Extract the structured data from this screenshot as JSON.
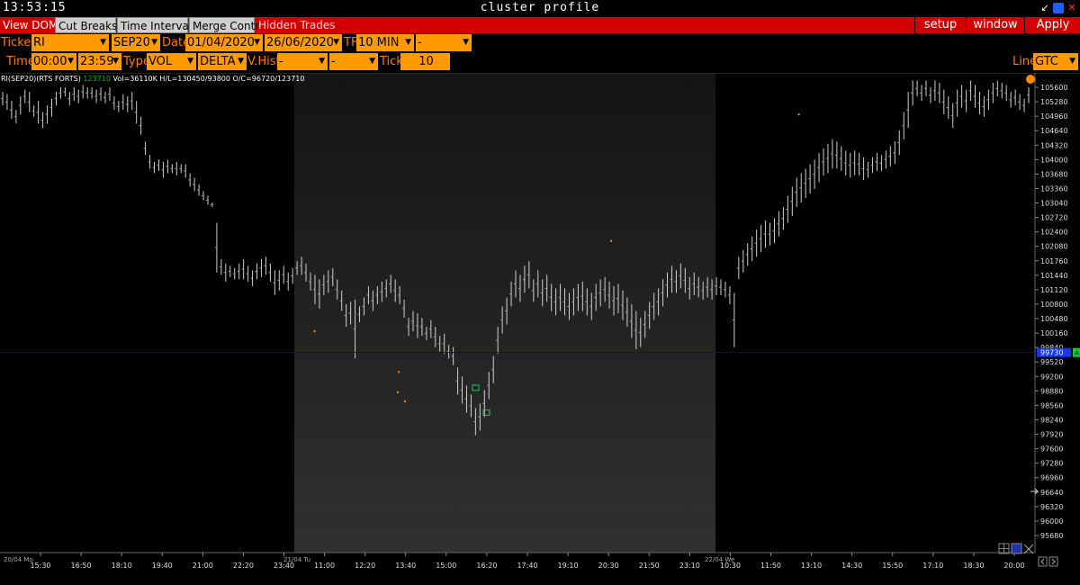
{
  "titlebar": {
    "clock": "13:53:15",
    "title": "cluster profile"
  },
  "menubar": {
    "tabs": [
      {
        "label": "View DOM",
        "state": "off"
      },
      {
        "label": "Cut Breaks",
        "state": "on"
      },
      {
        "label": "Time Interval",
        "state": "on"
      },
      {
        "label": "Merge Contr",
        "state": "on"
      },
      {
        "label": "Hidden Trades",
        "state": "hid"
      }
    ],
    "right": [
      "setup",
      "window",
      "Apply"
    ]
  },
  "row1": {
    "ticker_label": "Ticker",
    "ticker": "RI",
    "contract": "SEP20",
    "date_label": "Date",
    "date_from": "01/04/2020",
    "date_to": "26/06/2020",
    "tf_label": "TF",
    "tf": "10 MIN",
    "tf2": "-"
  },
  "row2": {
    "time_label": "Time",
    "time_from": "00:00",
    "time_to": "23:59",
    "type_label": "Type",
    "type": "VOL",
    "type2": "DELTA",
    "vhist_label": "V.Hist",
    "vhist1": "-",
    "vhist2": "-",
    "tick_label": "Tick",
    "tick": "10",
    "line_label": "Line",
    "line": "GTC"
  },
  "legend": {
    "symbol": "RI(SEP20)(RTS FORTS)",
    "last": "123710",
    "stats": "Vol=36110K  H/L=130450/93800  O/C=96720/123710"
  },
  "colors": {
    "menubar": "#d40000",
    "field": "#ff9a00",
    "label": "#ff7a00",
    "session_shade": "#2a2a2a",
    "hline": "#0000c8",
    "price_tag": "#1a33ff",
    "ask_tag": "#00d040"
  },
  "chart_data": {
    "type": "line",
    "y_ticks": [
      "105600",
      "105280",
      "104960",
      "104640",
      "104320",
      "104000",
      "103680",
      "103360",
      "103040",
      "102720",
      "102400",
      "102080",
      "101760",
      "101440",
      "101120",
      "100800",
      "100480",
      "100160",
      "99840",
      "99520",
      "99200",
      "98880",
      "98560",
      "98240",
      "97920",
      "97600",
      "97280",
      "96960",
      "96640",
      "96320",
      "96000",
      "95680"
    ],
    "x_ticks": [
      "15:30",
      "16:50",
      "18:10",
      "19:40",
      "21:00",
      "22:20",
      "23:40",
      "11:00",
      "12:20",
      "13:40",
      "15:00",
      "16:20",
      "17:40",
      "19:10",
      "20:30",
      "21:50",
      "23:10",
      "10:30",
      "11:50",
      "13:10",
      "14:30",
      "15:50",
      "17:10",
      "18:30",
      "20:00"
    ],
    "date_markers": [
      "20/04 Mo",
      "21/04 Tu",
      "22/04 We"
    ],
    "current_price": "99730",
    "ask_tag": "A",
    "ylim": [
      95520,
      105760
    ],
    "bars": [
      [
        105500,
        105200
      ],
      [
        105450,
        105100
      ],
      [
        105300,
        104900
      ],
      [
        105100,
        104800
      ],
      [
        105400,
        105000
      ],
      [
        105550,
        105250
      ],
      [
        105500,
        105050
      ],
      [
        105200,
        104950
      ],
      [
        105300,
        104800
      ],
      [
        105050,
        104700
      ],
      [
        105200,
        104800
      ],
      [
        105350,
        104950
      ],
      [
        105500,
        105200
      ],
      [
        105600,
        105350
      ],
      [
        105600,
        105400
      ],
      [
        105500,
        105200
      ],
      [
        105600,
        105300
      ],
      [
        105550,
        105250
      ],
      [
        105650,
        105350
      ],
      [
        105600,
        105350
      ],
      [
        105600,
        105350
      ],
      [
        105550,
        105250
      ],
      [
        105600,
        105300
      ],
      [
        105500,
        105250
      ],
      [
        105600,
        105300
      ],
      [
        105400,
        105100
      ],
      [
        105300,
        105050
      ],
      [
        105450,
        105100
      ],
      [
        105400,
        105050
      ],
      [
        105500,
        105100
      ],
      [
        105300,
        104800
      ],
      [
        104950,
        104550
      ],
      [
        104400,
        104100
      ],
      [
        104100,
        103800
      ],
      [
        103950,
        103700
      ],
      [
        104000,
        103750
      ],
      [
        103950,
        103600
      ],
      [
        104000,
        103700
      ],
      [
        103900,
        103700
      ],
      [
        103950,
        103650
      ],
      [
        103900,
        103700
      ],
      [
        103900,
        103600
      ],
      [
        103700,
        103400
      ],
      [
        103600,
        103300
      ],
      [
        103450,
        103200
      ],
      [
        103300,
        103100
      ],
      [
        103200,
        103000
      ],
      [
        103050,
        102950
      ],
      [
        102600,
        101500
      ],
      [
        101800,
        101450
      ],
      [
        101700,
        101300
      ],
      [
        101650,
        101400
      ],
      [
        101600,
        101350
      ],
      [
        101700,
        101350
      ],
      [
        101800,
        101350
      ],
      [
        101650,
        101300
      ],
      [
        101550,
        101200
      ],
      [
        101700,
        101350
      ],
      [
        101800,
        101400
      ],
      [
        101850,
        101450
      ],
      [
        101700,
        101300
      ],
      [
        101550,
        101000
      ],
      [
        101550,
        101100
      ],
      [
        101650,
        101250
      ],
      [
        101500,
        101100
      ],
      [
        101600,
        101250
      ],
      [
        101750,
        101450
      ],
      [
        101850,
        101450
      ],
      [
        101700,
        101300
      ],
      [
        101500,
        101100
      ],
      [
        101450,
        100800
      ],
      [
        101350,
        100700
      ],
      [
        101450,
        101000
      ],
      [
        101550,
        101050
      ],
      [
        101600,
        101200
      ],
      [
        101350,
        100900
      ],
      [
        101100,
        100650
      ],
      [
        100800,
        100300
      ],
      [
        100850,
        100350
      ],
      [
        100900,
        99600
      ],
      [
        100750,
        100400
      ],
      [
        100950,
        100550
      ],
      [
        101200,
        100800
      ],
      [
        101100,
        100650
      ],
      [
        101200,
        100800
      ],
      [
        101300,
        100850
      ],
      [
        101350,
        100950
      ],
      [
        101450,
        101050
      ],
      [
        101350,
        100850
      ],
      [
        101200,
        100800
      ],
      [
        100900,
        100500
      ],
      [
        100500,
        100100
      ],
      [
        100650,
        100200
      ],
      [
        100600,
        100050
      ],
      [
        100500,
        100100
      ],
      [
        100300,
        100000
      ],
      [
        100450,
        100050
      ],
      [
        100300,
        99850
      ],
      [
        100100,
        99750
      ],
      [
        100150,
        99700
      ],
      [
        99900,
        99600
      ],
      [
        99850,
        99450
      ],
      [
        99400,
        98800
      ],
      [
        99200,
        98600
      ],
      [
        99000,
        98400
      ],
      [
        98800,
        98300
      ],
      [
        98500,
        97900
      ],
      [
        98600,
        98000
      ],
      [
        98900,
        98300
      ],
      [
        99300,
        98700
      ],
      [
        99650,
        99050
      ],
      [
        100300,
        99700
      ],
      [
        100750,
        100150
      ],
      [
        100950,
        100350
      ],
      [
        101300,
        100750
      ],
      [
        101550,
        100950
      ],
      [
        101450,
        100850
      ],
      [
        101650,
        101050
      ],
      [
        101750,
        101150
      ],
      [
        101350,
        100850
      ],
      [
        101550,
        100950
      ],
      [
        101350,
        100750
      ],
      [
        101450,
        100850
      ],
      [
        101250,
        100650
      ],
      [
        101150,
        100550
      ],
      [
        101250,
        100650
      ],
      [
        101150,
        100550
      ],
      [
        101050,
        100450
      ],
      [
        101150,
        100550
      ],
      [
        101250,
        100650
      ],
      [
        101300,
        100650
      ],
      [
        101150,
        100550
      ],
      [
        101050,
        100450
      ],
      [
        101250,
        100650
      ],
      [
        101350,
        100750
      ],
      [
        101400,
        100850
      ],
      [
        101300,
        100700
      ],
      [
        101200,
        100550
      ],
      [
        101250,
        100600
      ],
      [
        101100,
        100450
      ],
      [
        100950,
        100300
      ],
      [
        100800,
        100050
      ],
      [
        100650,
        99800
      ],
      [
        100500,
        99850
      ],
      [
        100650,
        100050
      ],
      [
        100850,
        100250
      ],
      [
        101050,
        100450
      ],
      [
        101150,
        100550
      ],
      [
        101350,
        100750
      ],
      [
        101500,
        100950
      ],
      [
        101650,
        101050
      ],
      [
        101550,
        101050
      ],
      [
        101700,
        101150
      ],
      [
        101600,
        101050
      ],
      [
        101400,
        100900
      ],
      [
        101500,
        101000
      ],
      [
        101400,
        100950
      ],
      [
        101300,
        100900
      ],
      [
        101400,
        100950
      ],
      [
        101350,
        100900
      ],
      [
        101400,
        101000
      ],
      [
        101350,
        101000
      ],
      [
        101300,
        100950
      ],
      [
        101200,
        100800
      ],
      [
        101050,
        99850
      ],
      [
        101850,
        101350
      ],
      [
        102000,
        101500
      ],
      [
        102150,
        101650
      ],
      [
        102300,
        101750
      ],
      [
        102450,
        101850
      ],
      [
        102550,
        101950
      ],
      [
        102650,
        102050
      ],
      [
        102600,
        102100
      ],
      [
        102700,
        102150
      ],
      [
        102850,
        102300
      ],
      [
        102950,
        102450
      ],
      [
        103200,
        102600
      ],
      [
        103400,
        102750
      ],
      [
        103600,
        102950
      ],
      [
        103700,
        103050
      ],
      [
        103800,
        103150
      ],
      [
        103900,
        103250
      ],
      [
        104000,
        103350
      ],
      [
        104150,
        103500
      ],
      [
        104250,
        103650
      ],
      [
        104350,
        103700
      ],
      [
        104450,
        103800
      ],
      [
        104400,
        103800
      ],
      [
        104300,
        103750
      ],
      [
        104200,
        103650
      ],
      [
        104150,
        103600
      ],
      [
        104200,
        103650
      ],
      [
        104150,
        103650
      ],
      [
        104050,
        103550
      ],
      [
        103950,
        103600
      ],
      [
        104050,
        103700
      ],
      [
        104150,
        103750
      ],
      [
        104100,
        103750
      ],
      [
        104200,
        103800
      ],
      [
        104300,
        103850
      ],
      [
        104400,
        103900
      ],
      [
        104650,
        104100
      ],
      [
        105050,
        104450
      ],
      [
        105500,
        104700
      ],
      [
        105750,
        105200
      ],
      [
        105750,
        105400
      ],
      [
        105650,
        105300
      ],
      [
        105750,
        105400
      ],
      [
        105600,
        105250
      ],
      [
        105750,
        105300
      ],
      [
        105700,
        105250
      ],
      [
        105550,
        105000
      ],
      [
        105400,
        104900
      ],
      [
        105250,
        104700
      ],
      [
        105550,
        104950
      ],
      [
        105650,
        105150
      ],
      [
        105550,
        105050
      ],
      [
        105750,
        105300
      ],
      [
        105650,
        105150
      ],
      [
        105500,
        105000
      ],
      [
        105400,
        104950
      ],
      [
        105550,
        105100
      ],
      [
        105700,
        105250
      ],
      [
        105750,
        105400
      ],
      [
        105700,
        105350
      ],
      [
        105650,
        105300
      ],
      [
        105500,
        105150
      ],
      [
        105550,
        105200
      ],
      [
        105450,
        105100
      ],
      [
        105350,
        105050
      ],
      [
        105600,
        105250
      ]
    ]
  }
}
